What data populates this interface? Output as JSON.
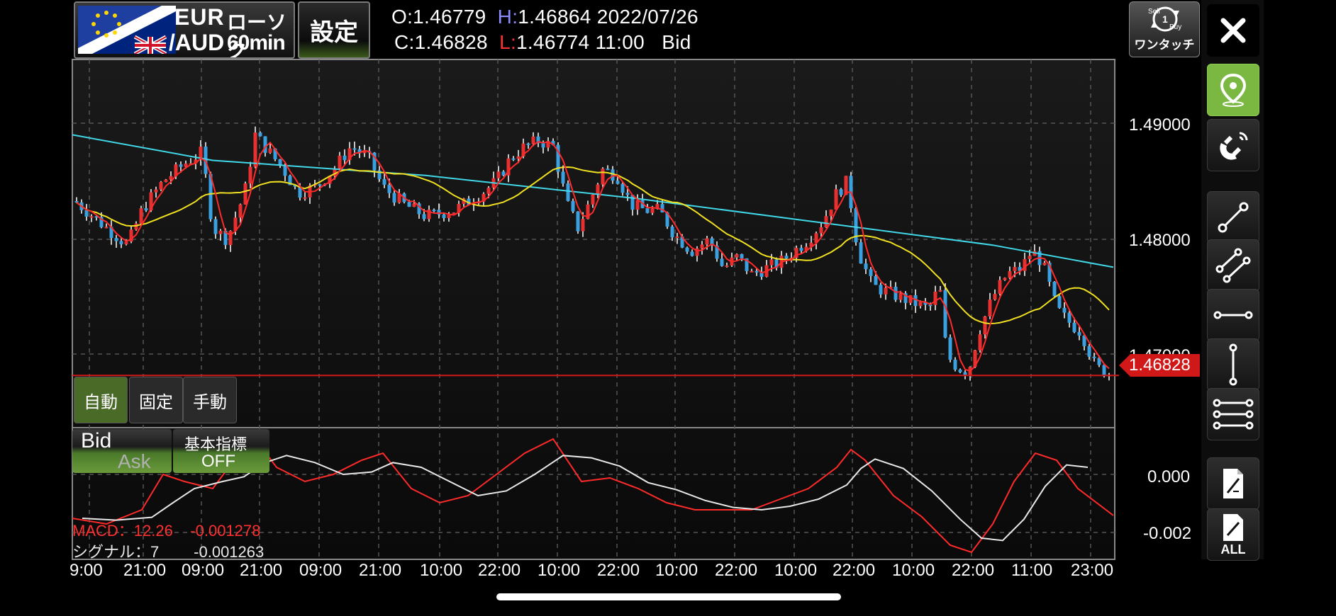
{
  "header": {
    "pair_base": "EUR",
    "pair_quote": "/AUD",
    "chart_kind": "ローソク",
    "timeframe": "60min",
    "settings_label": "設定",
    "ohlc": {
      "o_label": "O:",
      "o_value": "1.46779",
      "h_label": "H:",
      "h_value": "1.46864",
      "date": "2022/07/26",
      "c_label": "C:",
      "c_value": "1.46828",
      "l_label": "L:",
      "l_value": "1.46774",
      "time": "11:00",
      "side": "Bid"
    },
    "one_touch": {
      "label": "ワンタッチ",
      "sell_text": "Sell",
      "buy_text": "Buy",
      "qty": "1"
    }
  },
  "toolbar": {
    "close_icon": "close-icon",
    "pin_icon": "location-pin-icon",
    "magnet_icon": "magnet-icon",
    "tools": [
      "trend-line-icon",
      "parallel-lines-icon",
      "horizontal-line-icon",
      "vertical-line-icon",
      "fibonacci-lines-icon"
    ],
    "delete_icon": "delete-drawing-icon",
    "delete_all_label": "ALL"
  },
  "chart": {
    "price_labels": [
      "1.49000",
      "1.48000",
      "1.47000"
    ],
    "current_price": "1.46828",
    "time_labels": [
      "9:00",
      "21:00",
      "09:00",
      "21:00",
      "09:00",
      "21:00",
      "10:00",
      "22:00",
      "10:00",
      "22:00",
      "10:00",
      "22:00",
      "10:00",
      "22:00",
      "10:00",
      "22:00",
      "11:00",
      "23:00"
    ],
    "scale_modes": [
      "自動",
      "固定",
      "手動"
    ],
    "scale_mode_active": "自動",
    "bid_label": "Bid",
    "ask_label": "Ask",
    "indicator_label": "基本指標",
    "indicator_state": "OFF",
    "colors": {
      "bull": "#e83030",
      "bear": "#3aa0e0",
      "wick": "#ffffff",
      "ma_short": "#ff2a2a",
      "ma_mid": "#f0e020",
      "ma_long": "#40d8e8",
      "macd": "#ff2a2a",
      "signal": "#e8e8e8",
      "price_tag": "#d01818",
      "active_chip": "#4a6a28"
    }
  },
  "macd": {
    "macd_label": "MACD：12.26",
    "macd_value": "-0.001278",
    "signal_label": "シグナル：7",
    "signal_value": "-0.001263",
    "axis_labels": [
      "0.000",
      "-0.002"
    ]
  }
}
